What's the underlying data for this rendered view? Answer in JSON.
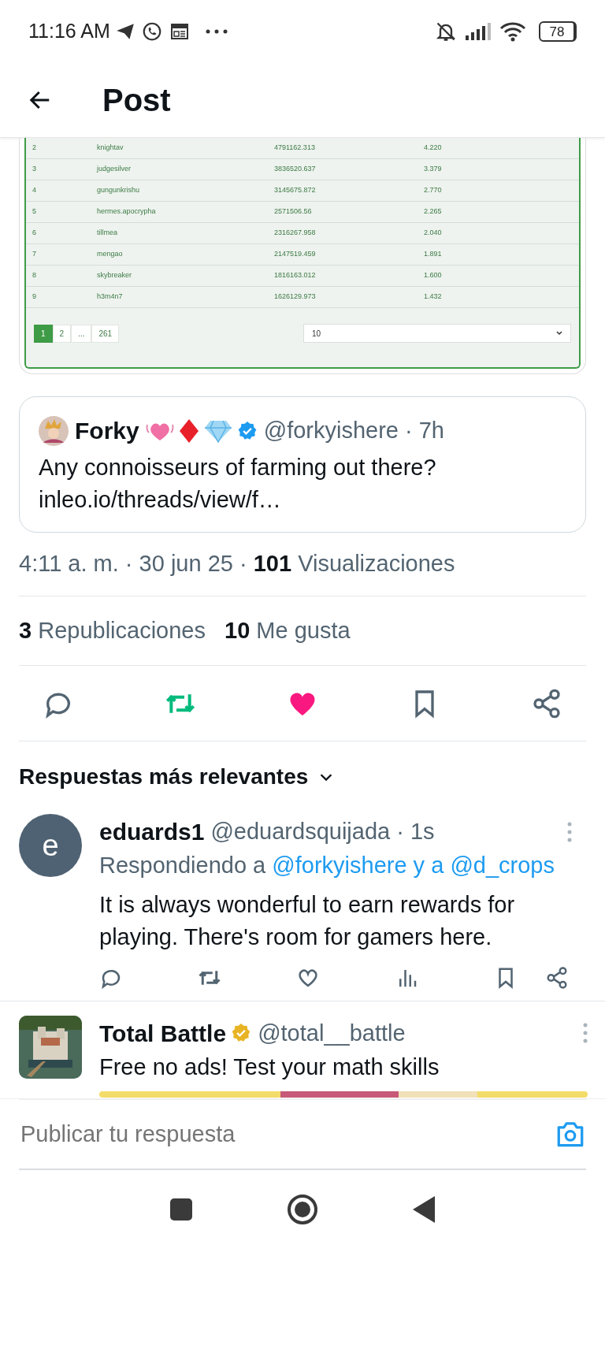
{
  "status_bar": {
    "time": "11:16 AM",
    "battery": "78"
  },
  "header": {
    "title": "Post"
  },
  "embedded_table": {
    "rows": [
      [
        "2",
        "knightav",
        "4791162.313",
        "4.220"
      ],
      [
        "3",
        "judgesilver",
        "3836520.637",
        "3.379"
      ],
      [
        "4",
        "gungunkrishu",
        "3145675.872",
        "2.770"
      ],
      [
        "5",
        "hermes.apocrypha",
        "2571506.56",
        "2.265"
      ],
      [
        "6",
        "tillmea",
        "2316267.958",
        "2.040"
      ],
      [
        "7",
        "mengao",
        "2147519.459",
        "1.891"
      ],
      [
        "8",
        "skybreaker",
        "1816163.012",
        "1.600"
      ],
      [
        "9",
        "h3m4n7",
        "1626129.973",
        "1.432"
      ]
    ],
    "pagination": [
      {
        "label": "1",
        "selected": true
      },
      {
        "label": "2",
        "selected": false
      },
      {
        "label": "...",
        "selected": false
      },
      {
        "label": "261",
        "selected": false
      }
    ],
    "page_size": "10"
  },
  "quoted_post": {
    "name": "Forky",
    "badge": {
      "color": "#1d9bf0"
    },
    "handle_line": "@forkyishere · 7h",
    "text": "Any connoisseurs of farming out there?",
    "link": "inleo.io/threads/view/f…"
  },
  "meta": "4:11 a. m. · 30 jun 25 · **101** Visualizaciones",
  "stats": [
    "**3** Republicaciones",
    "**10** Me gusta"
  ],
  "actions": [
    {
      "kind": "reply",
      "active": false
    },
    {
      "kind": "repost",
      "active": true
    },
    {
      "kind": "like",
      "active": true
    },
    {
      "kind": "bookmark",
      "active": false
    },
    {
      "kind": "share",
      "active": false
    }
  ],
  "replies_sort": "Respuestas más relevantes",
  "reply": {
    "avatar_letter": "e",
    "name": "eduards1",
    "handle_line": "@eduardsquijada · 1s",
    "replying_prefix": "Respondiendo a",
    "mentions": [
      "@forkyishere y a",
      "@d_crops"
    ],
    "text": "It is always wonderful to earn rewards for playing. There's room for gamers here.",
    "actions": [
      {
        "kind": "reply"
      },
      {
        "kind": "repost"
      },
      {
        "kind": "like"
      },
      {
        "kind": "views"
      },
      {
        "kind": "bookmark"
      },
      {
        "kind": "share"
      }
    ]
  },
  "promoted_post": {
    "name": "Total Battle",
    "badge": {
      "color": "#e8b425"
    },
    "handle_line": "@total__battle",
    "text": "Free no ads! Test your math skills"
  },
  "composer": {
    "placeholder": "Publicar tu respuesta"
  }
}
